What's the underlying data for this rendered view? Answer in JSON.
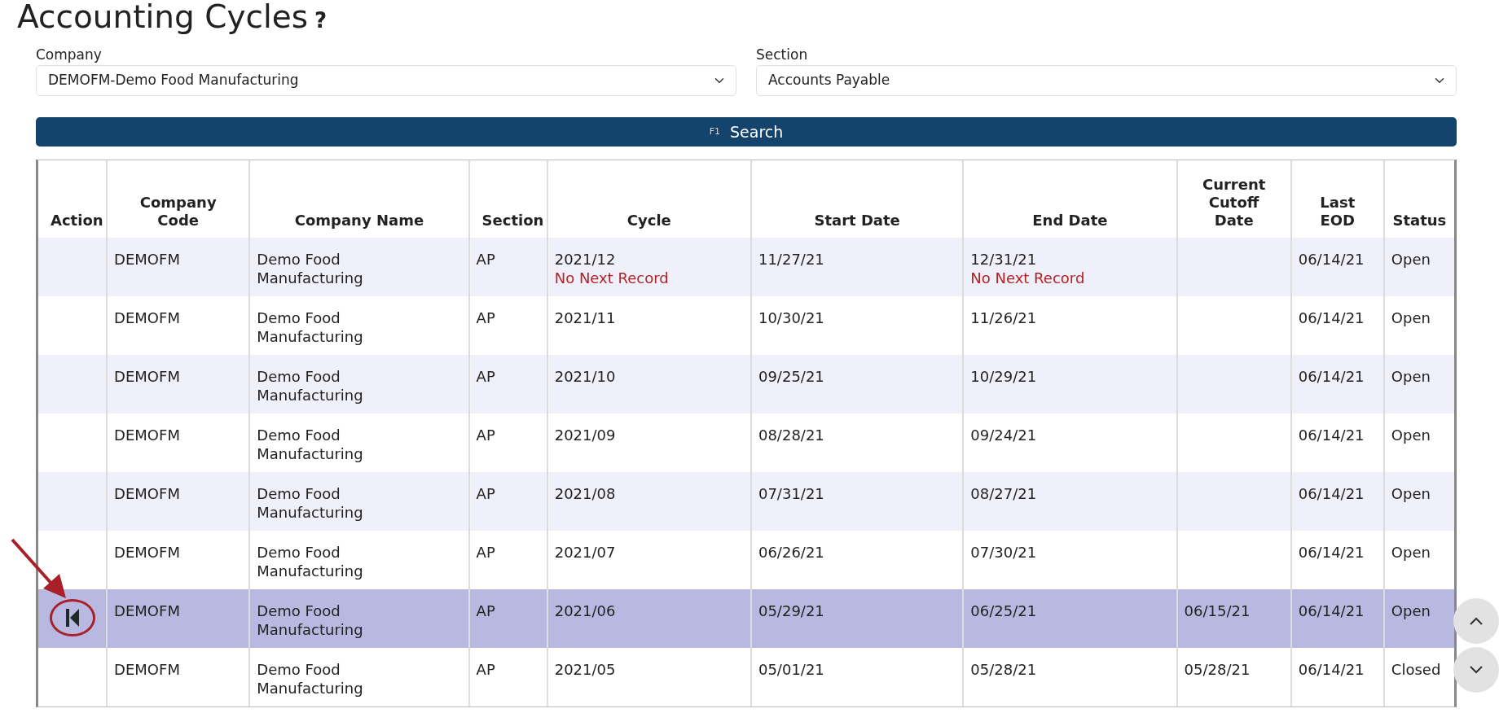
{
  "title": "Accounting Cycles",
  "help": "?",
  "filters": [
    {
      "label": "Company",
      "value": "DEMOFM-Demo Food Manufacturing"
    },
    {
      "label": "Section",
      "value": "Accounts Payable"
    }
  ],
  "search_button": {
    "key_hint": "F1",
    "label": "Search"
  },
  "table": {
    "columns": [
      "Action",
      "Company Code",
      "Company Name",
      "Section",
      "Cycle",
      "Start Date",
      "End Date",
      "Current Cutoff Date",
      "Last EOD",
      "Status"
    ],
    "rows": [
      {
        "selected": false,
        "company_code": "DEMOFM",
        "company_name": "Demo Food Manufacturing",
        "section": "AP",
        "cycle": "2021/12",
        "cycle_note": "No Next Record",
        "start_date": "11/27/21",
        "end_date": "12/31/21",
        "end_note": "No Next Record",
        "cutoff_date": "",
        "last_eod": "06/14/21",
        "status": "Open"
      },
      {
        "selected": false,
        "company_code": "DEMOFM",
        "company_name": "Demo Food Manufacturing",
        "section": "AP",
        "cycle": "2021/11",
        "start_date": "10/30/21",
        "end_date": "11/26/21",
        "cutoff_date": "",
        "last_eod": "06/14/21",
        "status": "Open"
      },
      {
        "selected": false,
        "company_code": "DEMOFM",
        "company_name": "Demo Food Manufacturing",
        "section": "AP",
        "cycle": "2021/10",
        "start_date": "09/25/21",
        "end_date": "10/29/21",
        "cutoff_date": "",
        "last_eod": "06/14/21",
        "status": "Open"
      },
      {
        "selected": false,
        "company_code": "DEMOFM",
        "company_name": "Demo Food Manufacturing",
        "section": "AP",
        "cycle": "2021/09",
        "start_date": "08/28/21",
        "end_date": "09/24/21",
        "cutoff_date": "",
        "last_eod": "06/14/21",
        "status": "Open"
      },
      {
        "selected": false,
        "company_code": "DEMOFM",
        "company_name": "Demo Food Manufacturing",
        "section": "AP",
        "cycle": "2021/08",
        "start_date": "07/31/21",
        "end_date": "08/27/21",
        "cutoff_date": "",
        "last_eod": "06/14/21",
        "status": "Open"
      },
      {
        "selected": false,
        "company_code": "DEMOFM",
        "company_name": "Demo Food Manufacturing",
        "section": "AP",
        "cycle": "2021/07",
        "start_date": "06/26/21",
        "end_date": "07/30/21",
        "cutoff_date": "",
        "last_eod": "06/14/21",
        "status": "Open"
      },
      {
        "selected": true,
        "company_code": "DEMOFM",
        "company_name": "Demo Food Manufacturing",
        "section": "AP",
        "cycle": "2021/06",
        "start_date": "05/29/21",
        "end_date": "06/25/21",
        "cutoff_date": "06/15/21",
        "last_eod": "06/14/21",
        "status": "Open"
      },
      {
        "selected": false,
        "company_code": "DEMOFM",
        "company_name": "Demo Food Manufacturing",
        "section": "AP",
        "cycle": "2021/05",
        "start_date": "05/01/21",
        "end_date": "05/28/21",
        "cutoff_date": "05/28/21",
        "last_eod": "06/14/21",
        "status": "Closed"
      }
    ]
  }
}
